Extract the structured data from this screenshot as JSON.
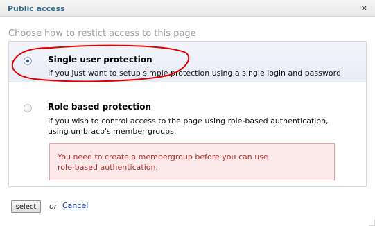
{
  "dialog": {
    "title": "Public access",
    "close_glyph": "×"
  },
  "heading": "Choose how to restict access to this page",
  "options": [
    {
      "title": "Single user protection",
      "description": "If you just want to setup simple protection using a single login and password",
      "selected": true
    },
    {
      "title": "Role based protection",
      "description_line1": "If you wish to control access to the page using role-based authentication,",
      "description_line2": "using umbraco's member groups.",
      "selected": false
    }
  ],
  "warning": {
    "line1": "You need to create a membergroup before you can use",
    "line2": "role-based authentication."
  },
  "footer": {
    "select_label": "select",
    "or_label": "or",
    "cancel_label": "Cancel"
  },
  "colors": {
    "title": "#2f6c8c",
    "warning_text": "#b0302c",
    "warning_bg": "#fbe9e9",
    "annotation": "#e00000"
  }
}
